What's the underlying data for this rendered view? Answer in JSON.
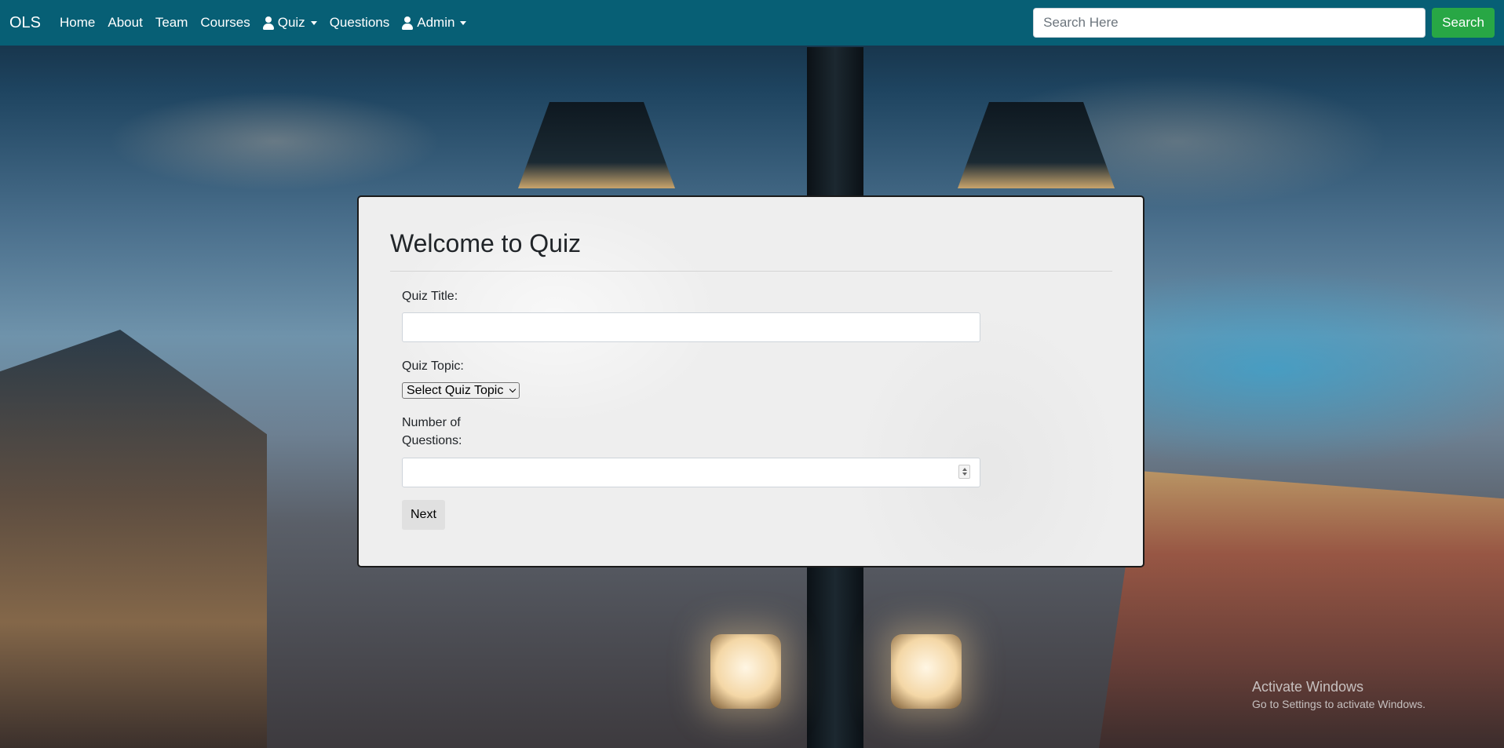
{
  "navbar": {
    "brand": "OLS",
    "links": {
      "home": "Home",
      "about": "About",
      "team": "Team",
      "courses": "Courses",
      "quiz": "Quiz",
      "questions": "Questions",
      "admin": "Admin"
    },
    "search": {
      "placeholder": "Search Here",
      "value": "",
      "button_label": "Search"
    },
    "background_color": "#075f75",
    "search_button_color": "#28a745"
  },
  "quiz_form": {
    "title": "Welcome to Quiz",
    "quiz_title_label": "Quiz Title:",
    "quiz_title_value": "",
    "quiz_topic_label": "Quiz Topic:",
    "quiz_topic_selected": "Select Quiz Topic",
    "num_questions_label_line1": "Number of",
    "num_questions_label_line2": "Questions:",
    "num_questions_value": "",
    "next_label": "Next"
  },
  "icons": {
    "quiz_menu": "user-icon",
    "admin_menu": "user-icon"
  },
  "watermark": {
    "title": "Activate Windows",
    "subtitle": "Go to Settings to activate Windows."
  }
}
